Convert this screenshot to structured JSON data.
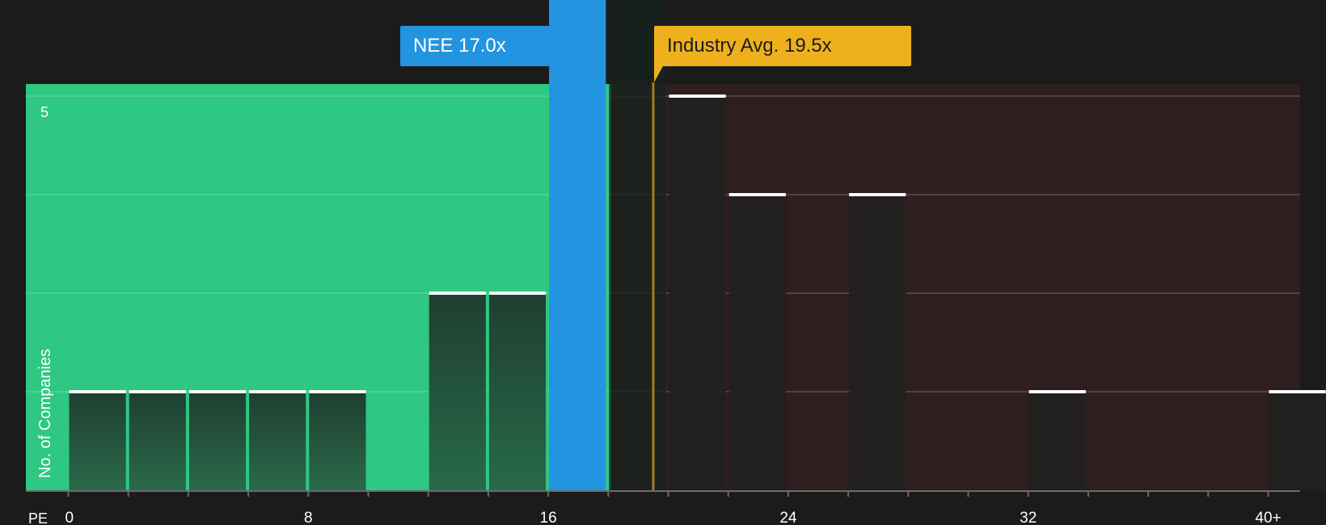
{
  "chart_data": {
    "type": "bar",
    "xlabel": "PE",
    "ylabel": "No. of Companies",
    "x_ticks": [
      "0",
      "8",
      "16",
      "24",
      "32",
      "40+"
    ],
    "y_ticks": [
      "5"
    ],
    "ylim": [
      0,
      5
    ],
    "bin_width": 2,
    "bins": [
      {
        "start": 0,
        "end": 2,
        "count": 1
      },
      {
        "start": 2,
        "end": 4,
        "count": 1
      },
      {
        "start": 4,
        "end": 6,
        "count": 1
      },
      {
        "start": 6,
        "end": 8,
        "count": 1
      },
      {
        "start": 8,
        "end": 10,
        "count": 1
      },
      {
        "start": 10,
        "end": 12,
        "count": 0
      },
      {
        "start": 12,
        "end": 14,
        "count": 2
      },
      {
        "start": 14,
        "end": 16,
        "count": 2
      },
      {
        "start": 16,
        "end": 18,
        "count": 5
      },
      {
        "start": 18,
        "end": 20,
        "count": 5
      },
      {
        "start": 20,
        "end": 22,
        "count": 4
      },
      {
        "start": 22,
        "end": 24,
        "count": 3
      },
      {
        "start": 24,
        "end": 26,
        "count": 0
      },
      {
        "start": 26,
        "end": 28,
        "count": 3
      },
      {
        "start": 28,
        "end": 30,
        "count": 0
      },
      {
        "start": 30,
        "end": 32,
        "count": 0
      },
      {
        "start": 32,
        "end": 34,
        "count": 1
      },
      {
        "start": 34,
        "end": 36,
        "count": 0
      },
      {
        "start": 36,
        "end": 38,
        "count": 0
      },
      {
        "start": 38,
        "end": 40,
        "count": 0
      },
      {
        "start": 40,
        "end": 42,
        "count": 1
      }
    ],
    "company": {
      "label": "NEE 17.0x",
      "value": 17.0
    },
    "industry": {
      "label": "Industry Avg. 19.5x",
      "value": 19.5
    },
    "grid": true,
    "colors": {
      "background": "#1b1b1c",
      "undervalued_zone": "#2ec882",
      "overvalued_zone": "#2e1e1f",
      "company_bar": "#2394e0",
      "industry_line": "#eeb01c",
      "bar_top": "#ffffff"
    }
  }
}
